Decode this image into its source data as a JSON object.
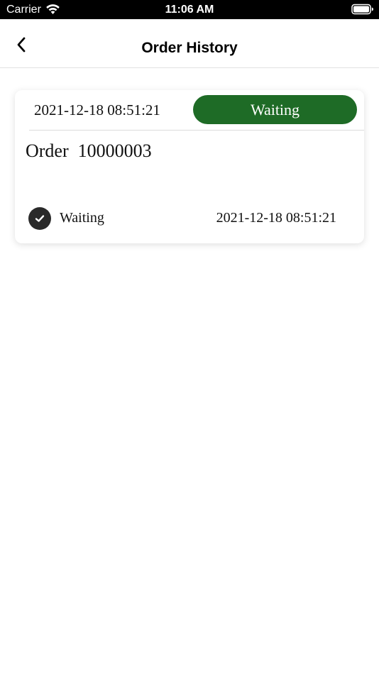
{
  "status_bar": {
    "carrier": "Carrier",
    "time": "11:06 AM",
    "wifi_icon": "wifi-icon",
    "battery_icon": "battery-icon"
  },
  "nav": {
    "title": "Order History",
    "back_icon": "chevron-left-icon"
  },
  "orders": [
    {
      "datetime": "2021-12-18 08:51:21",
      "status": "Waiting",
      "status_color": "#1e6b26",
      "title": "Order  10000003",
      "history": [
        {
          "status": "Waiting",
          "datetime": "2021-12-18 08:51:21",
          "icon": "check-circle-icon"
        }
      ]
    }
  ]
}
